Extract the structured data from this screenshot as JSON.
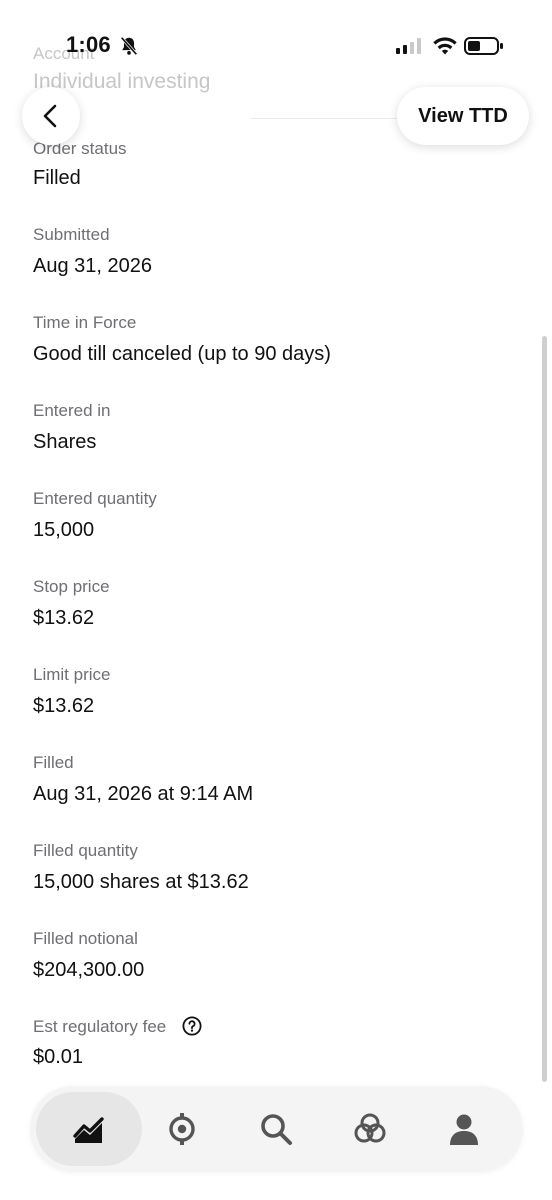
{
  "status_bar": {
    "time": "1:06"
  },
  "faded_header": {
    "label": "Account",
    "value": "Individual investing"
  },
  "header": {
    "view_button_label": "View TTD"
  },
  "details": [
    {
      "label": "Order status",
      "value": "Filled"
    },
    {
      "label": "Submitted",
      "value": "Aug 31, 2026"
    },
    {
      "label": "Time in Force",
      "value": "Good till canceled (up to 90 days)"
    },
    {
      "label": "Entered in",
      "value": "Shares"
    },
    {
      "label": "Entered quantity",
      "value": "15,000"
    },
    {
      "label": "Stop price",
      "value": "$13.62"
    },
    {
      "label": "Limit price",
      "value": "$13.62"
    },
    {
      "label": "Filled",
      "value": "Aug 31, 2026 at 9:14 AM"
    },
    {
      "label": "Filled quantity",
      "value": "15,000 shares at $13.62"
    },
    {
      "label": "Filled notional",
      "value": "$204,300.00"
    },
    {
      "label": "Est regulatory fee",
      "value": "$0.01"
    }
  ],
  "nav": {
    "items": [
      {
        "icon": "chart-icon",
        "active": true
      },
      {
        "icon": "crypto-icon",
        "active": false
      },
      {
        "icon": "search-icon",
        "active": false
      },
      {
        "icon": "rings-icon",
        "active": false
      },
      {
        "icon": "person-icon",
        "active": false
      }
    ]
  }
}
